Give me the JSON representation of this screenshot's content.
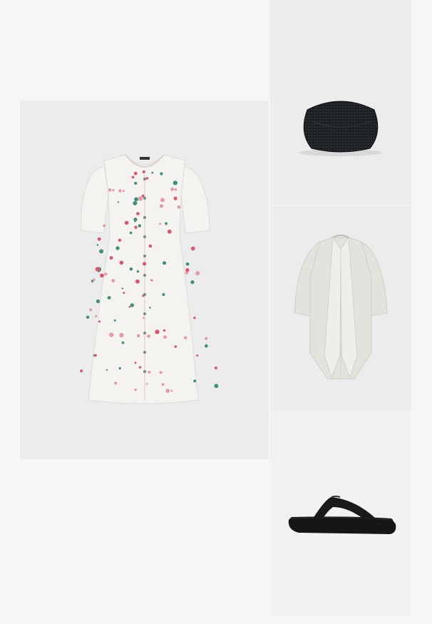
{
  "page": {
    "background": "#f6f6f6"
  },
  "outfit": {
    "items": [
      {
        "id": "dress",
        "bg": "#ececec",
        "fabric": "#f5f3ef",
        "print_colors": [
          "#d9566b",
          "#3f8f77",
          "#e39aa8"
        ]
      },
      {
        "id": "bag",
        "bg": "#ececec",
        "color": "#1c1f22"
      },
      {
        "id": "cardigan",
        "bg": "#ececec",
        "color": "#e4e2dd"
      },
      {
        "id": "sandal",
        "bg": "#ececec",
        "color": "#161616"
      }
    ]
  }
}
